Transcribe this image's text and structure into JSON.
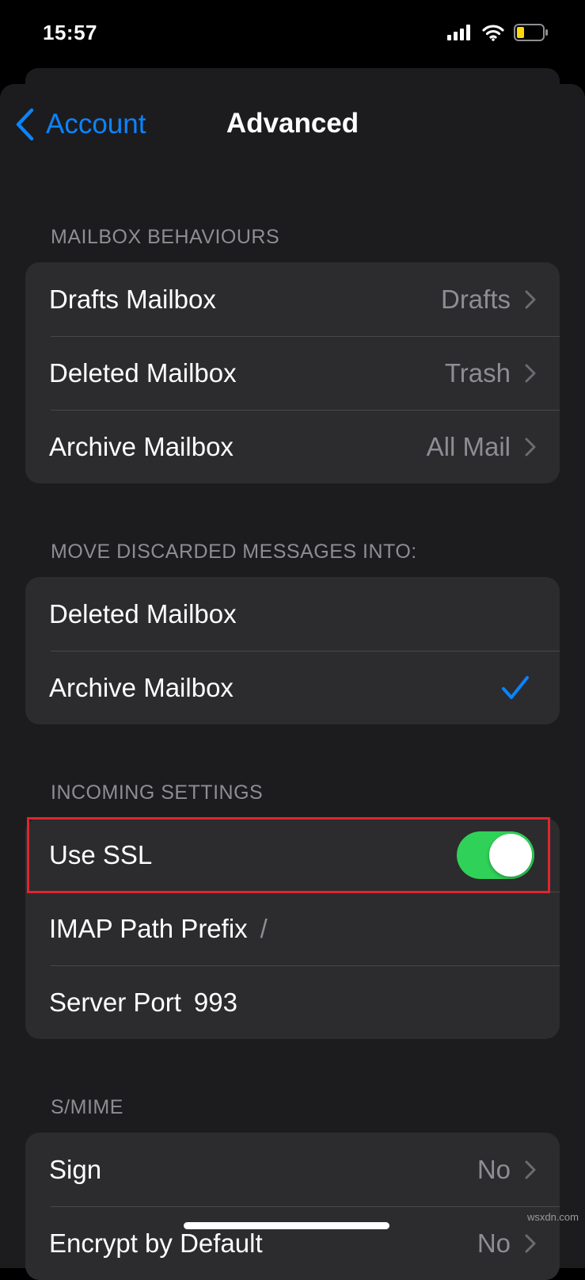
{
  "status_bar": {
    "time": "15:57"
  },
  "nav": {
    "back_label": "Account",
    "title": "Advanced"
  },
  "sections": {
    "mailbox_behaviours": {
      "header": "MAILBOX BEHAVIOURS",
      "rows": [
        {
          "label": "Drafts Mailbox",
          "value": "Drafts"
        },
        {
          "label": "Deleted Mailbox",
          "value": "Trash"
        },
        {
          "label": "Archive Mailbox",
          "value": "All Mail"
        }
      ]
    },
    "move_discarded": {
      "header": "MOVE DISCARDED MESSAGES INTO:",
      "rows": [
        {
          "label": "Deleted Mailbox",
          "selected": false
        },
        {
          "label": "Archive Mailbox",
          "selected": true
        }
      ]
    },
    "incoming_settings": {
      "header": "INCOMING SETTINGS",
      "use_ssl": {
        "label": "Use SSL",
        "enabled": true
      },
      "imap_path_prefix": {
        "label": "IMAP Path Prefix",
        "value": "/"
      },
      "server_port": {
        "label": "Server Port",
        "value": "993"
      }
    },
    "smime": {
      "header": "S/MIME",
      "rows": [
        {
          "label": "Sign",
          "value": "No"
        },
        {
          "label": "Encrypt by Default",
          "value": "No"
        }
      ]
    }
  },
  "colors": {
    "accent": "#0a84ff",
    "toggle_on": "#30d158",
    "highlight": "#e0252c",
    "background": "#1c1c1e",
    "cell": "#2c2c2e"
  },
  "watermark": "wsxdn.com"
}
